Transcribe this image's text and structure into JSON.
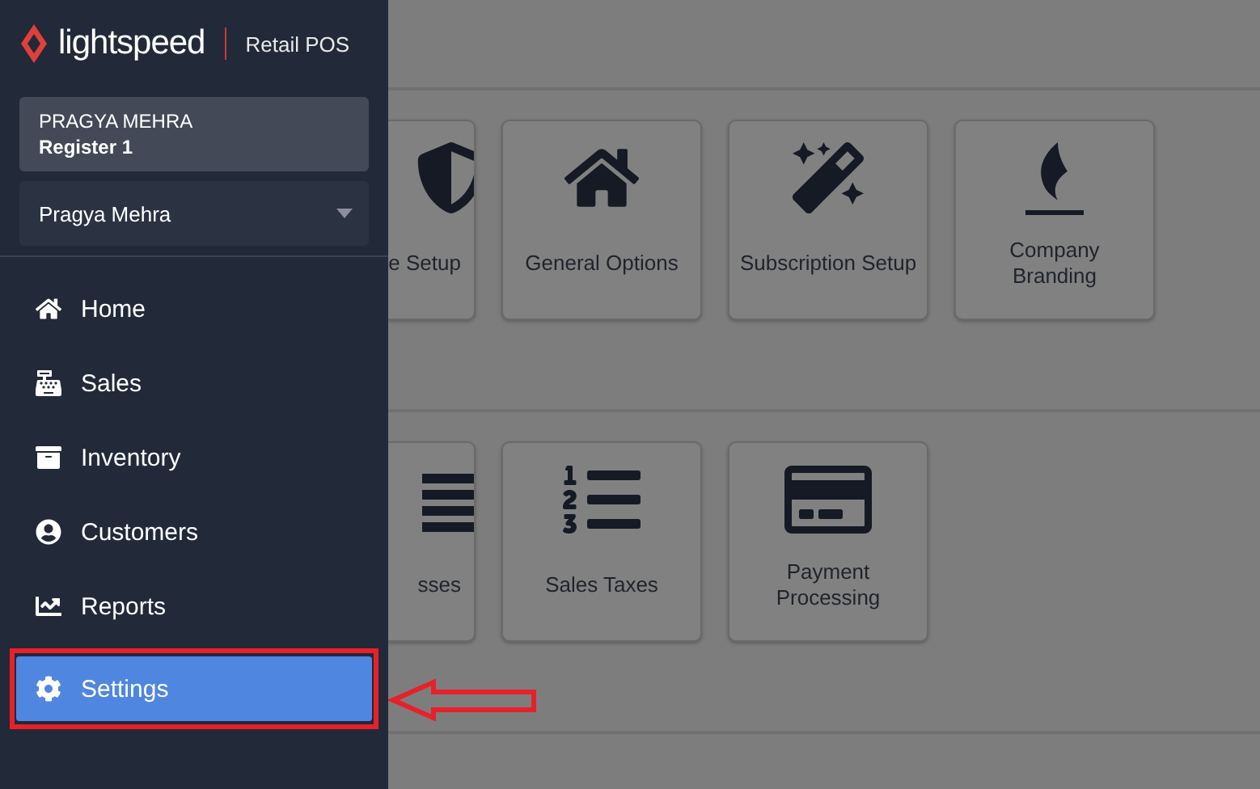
{
  "logo": {
    "brand": "lightspeed",
    "product": "Retail POS"
  },
  "account": {
    "user": "PRAGYA MEHRA",
    "register": "Register 1"
  },
  "user_select": {
    "value": "Pragya Mehra"
  },
  "nav": [
    {
      "label": "Home",
      "kind": "home",
      "selected": false
    },
    {
      "label": "Sales",
      "kind": "register",
      "selected": false
    },
    {
      "label": "Inventory",
      "kind": "archive",
      "selected": false
    },
    {
      "label": "Customers",
      "kind": "user",
      "selected": false
    },
    {
      "label": "Reports",
      "kind": "chart",
      "selected": false
    },
    {
      "label": "Settings",
      "kind": "gear",
      "selected": true
    }
  ],
  "sections": [
    {
      "tiles": [
        {
          "label": "e Setup",
          "kind": "shield"
        },
        {
          "label": "General Options",
          "kind": "house"
        },
        {
          "label": "Subscription Setup",
          "kind": "wand"
        },
        {
          "label": "Company Branding",
          "kind": "flame"
        }
      ]
    },
    {
      "tiles": [
        {
          "label": "sses",
          "kind": "bars"
        },
        {
          "label": "Sales Taxes",
          "kind": "numlist"
        },
        {
          "label": "Payment Processing",
          "kind": "card"
        }
      ]
    }
  ]
}
